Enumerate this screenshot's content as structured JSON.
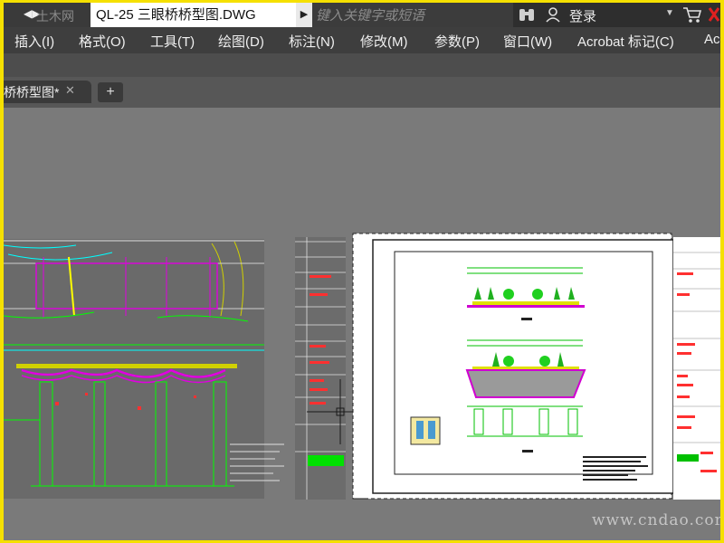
{
  "quick_access": {
    "arrow_glyph": "◀▶",
    "watermark_text": "土木网"
  },
  "document": {
    "title": "QL-25 三眼桥桥型图.DWG"
  },
  "search": {
    "placeholder": "键入关键字或短语"
  },
  "account": {
    "login_label": "登录"
  },
  "menu": {
    "items": [
      {
        "label": "插入(I)"
      },
      {
        "label": "格式(O)"
      },
      {
        "label": "工具(T)"
      },
      {
        "label": "绘图(D)"
      },
      {
        "label": "标注(N)"
      },
      {
        "label": "修改(M)"
      },
      {
        "label": "参数(P)"
      },
      {
        "label": "窗口(W)"
      },
      {
        "label": "Acrobat 标记(C)"
      },
      {
        "label": "Ac"
      }
    ]
  },
  "tabs": [
    {
      "label": "桥桥型图*",
      "close": "✕"
    }
  ],
  "new_tab": {
    "label": "+"
  },
  "watermark": {
    "text": "www.cndao.com"
  },
  "colors": {
    "border": "#f5e000",
    "canvas": "#7a7a7a",
    "drawing_green": "#00e000",
    "drawing_magenta": "#e000e0",
    "drawing_yellow": "#ffff00",
    "drawing_cyan": "#00ffff",
    "drawing_red": "#ff2020"
  }
}
